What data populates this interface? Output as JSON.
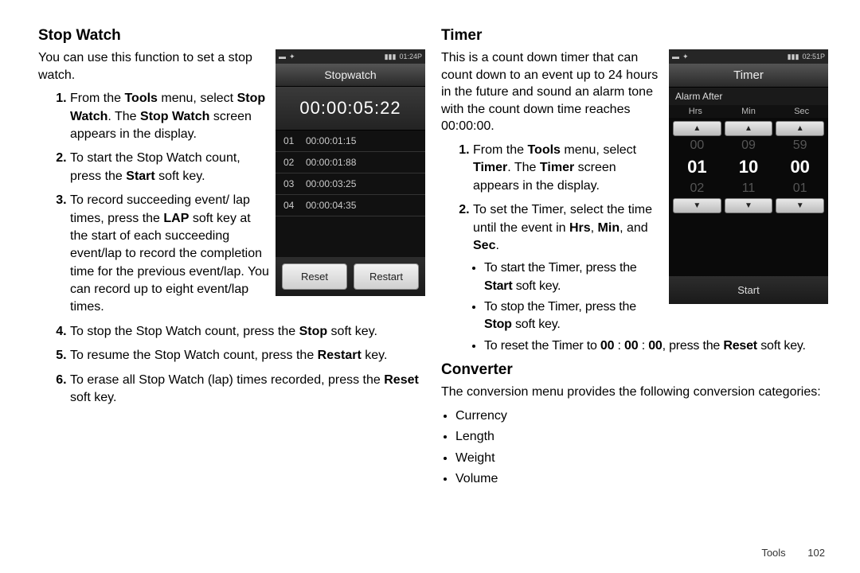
{
  "left": {
    "heading": "Stop Watch",
    "intro": "You can use this function to set a stop watch.",
    "steps": {
      "s1a": "From the ",
      "s1b": "Tools",
      "s1c": " menu, select ",
      "s1d": "Stop Watch",
      "s1e": ". The ",
      "s1f": "Stop Watch",
      "s1g": " screen appears in the display.",
      "s2a": "To start the Stop Watch count, press the ",
      "s2b": "Start",
      "s2c": " soft key.",
      "s3a": "To record succeeding event/ lap times, press the ",
      "s3b": "LAP",
      "s3c": " soft key at the start of each succeeding event/lap to record the completion time for the previous event/lap. You can record up to eight event/lap times.",
      "s4a": "To stop the Stop Watch count, press the ",
      "s4b": "Stop",
      "s4c": " soft key.",
      "s5a": "To resume the Stop Watch count, press the ",
      "s5b": "Restart",
      "s5c": " key.",
      "s6a": "To erase all Stop Watch (lap) times recorded, press the ",
      "s6b": "Reset",
      "s6c": " soft key."
    },
    "phone": {
      "status_time": "01:24P",
      "title": "Stopwatch",
      "main": "00:00:05:22",
      "laps": [
        {
          "n": "01",
          "t": "00:00:01:15"
        },
        {
          "n": "02",
          "t": "00:00:01:88"
        },
        {
          "n": "03",
          "t": "00:00:03:25"
        },
        {
          "n": "04",
          "t": "00:00:04:35"
        }
      ],
      "btn_reset": "Reset",
      "btn_restart": "Restart"
    }
  },
  "right": {
    "timer_heading": "Timer",
    "timer_intro": "This is a count down timer that can count down to an event up to 24 hours in the future and sound an alarm tone with the count down time reaches 00:00:00.",
    "t1a": "From the ",
    "t1b": "Tools",
    "t1c": " menu, select ",
    "t1d": "Timer",
    "t1e": ". The ",
    "t1f": "Timer",
    "t1g": " screen appears in the display.",
    "t2a": "To set the Timer, select the time until the event in ",
    "t2b": "Hrs",
    "t2c": ", ",
    "t2d": "Min",
    "t2e": ", and ",
    "t2f": "Sec",
    "t2g": ".",
    "b1a": "To start the Timer, press the ",
    "b1b": "Start",
    "b1c": " soft key.",
    "b2a": "To stop the Timer, press the ",
    "b2b": "Stop",
    "b2c": " soft key.",
    "b3a": "To reset the Timer to ",
    "b3b": "00",
    "b3c": " : ",
    "b3d": "00",
    "b3e": " : ",
    "b3f": "00",
    "b3g": ", press the ",
    "b3h": "Reset",
    "b3i": " soft key.",
    "phone": {
      "status_time": "02:51P",
      "title": "Timer",
      "sub": "Alarm After",
      "col_hrs": "Hrs",
      "col_min": "Min",
      "col_sec": "Sec",
      "hrs_prev": "00",
      "hrs_sel": "01",
      "hrs_next": "02",
      "min_prev": "09",
      "min_sel": "10",
      "min_next": "11",
      "sec_prev": "59",
      "sec_sel": "00",
      "sec_next": "01",
      "start": "Start",
      "up": "▲",
      "down": "▼"
    },
    "conv_heading": "Converter",
    "conv_intro": "The conversion menu provides the following conversion categories:",
    "conv": {
      "c1": "Currency",
      "c2": "Length",
      "c3": "Weight",
      "c4": "Volume"
    }
  },
  "footer": {
    "section": "Tools",
    "page": "102"
  }
}
